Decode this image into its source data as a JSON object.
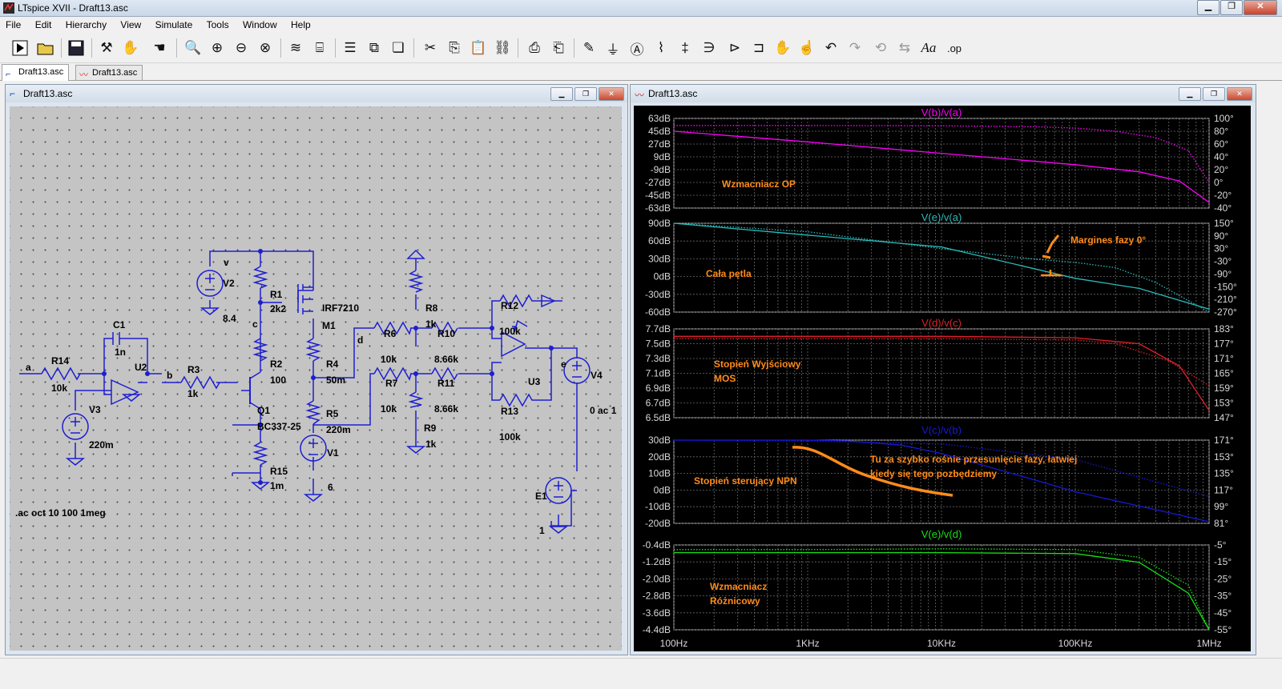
{
  "app": {
    "title": "LTspice XVII - Draft13.asc"
  },
  "menu": [
    "File",
    "Edit",
    "Hierarchy",
    "View",
    "Simulate",
    "Tools",
    "Window",
    "Help"
  ],
  "tabs": [
    {
      "label": "Draft13.asc"
    },
    {
      "label": "Draft13.asc"
    }
  ],
  "schematic": {
    "title": "Draft13.asc",
    "directive": ".ac oct 10 100 1meg",
    "labels": {
      "a": "a",
      "b": "b",
      "c": "c",
      "d": "d",
      "e": "e",
      "v": "v",
      "R14": "R14",
      "R14v": "10k",
      "C1": "C1",
      "C1v": "1n",
      "U2": "U2",
      "R3": "R3",
      "R3v": "1k",
      "V3": "V3",
      "V3v": "220m",
      "V2": "V2",
      "V2v": "8.4",
      "R1": "R1",
      "R1v": "2k2",
      "R2": "R2",
      "R2v": "100",
      "Q1": "Q1",
      "Q1v": "BC337-25",
      "R15": "R15",
      "R15v": "1m",
      "M1name": "IRF7210",
      "M1": "M1",
      "R4": "R4",
      "R4v": "50m",
      "R5": "R5",
      "R5v": "220m",
      "V1": "V1",
      "V1v": "6",
      "R6": "R6",
      "R6v": "10k",
      "R8": "R8",
      "R8v": "1k",
      "R10": "R10",
      "R10v": "8.66k",
      "R7": "R7",
      "R7v": "10k",
      "R9": "R9",
      "R9v": "1k",
      "R11": "R11",
      "R11v": "8.66k",
      "R12": "R12",
      "R12v": "100k",
      "R13": "R13",
      "R13v": "100k",
      "U3": "U3",
      "V4": "V4",
      "V4v": "0 ac 1",
      "E1": "E1",
      "E1v": "1"
    }
  },
  "waveform": {
    "title": "Draft13.asc"
  },
  "chart_data": [
    {
      "type": "line",
      "title": "V(b)/v(a)",
      "xscale": "log",
      "xlim": [
        100,
        1000000
      ],
      "left_ticks": [
        "63dB",
        "45dB",
        "27dB",
        "9dB",
        "-9dB",
        "-27dB",
        "-45dB",
        "-63dB"
      ],
      "right_ticks": [
        "100°",
        "80°",
        "60°",
        "40°",
        "20°",
        "0°",
        "-20°",
        "-40°"
      ],
      "ylim_left": [
        -63,
        63
      ],
      "ylim_right": [
        -40,
        100
      ],
      "annotation": "Wzmacniacz OP",
      "color": "#ff00ff",
      "series": [
        {
          "axis": "left",
          "style": "solid",
          "x": [
            100,
            1000,
            10000,
            100000,
            300000,
            600000,
            1000000
          ],
          "y": [
            45,
            30,
            14,
            -2,
            -12,
            -25,
            -55
          ]
        },
        {
          "axis": "right",
          "style": "dotted",
          "x": [
            100,
            1000,
            10000,
            50000,
            100000,
            200000,
            400000,
            700000,
            1000000
          ],
          "y": [
            89,
            89,
            88.5,
            87,
            85,
            80,
            70,
            50,
            0
          ]
        }
      ]
    },
    {
      "type": "line",
      "title": "V(e)/v(a)",
      "xscale": "log",
      "xlim": [
        100,
        1000000
      ],
      "left_ticks": [
        "90dB",
        "60dB",
        "30dB",
        "0dB",
        "-30dB",
        "-60dB"
      ],
      "right_ticks": [
        "150°",
        "90°",
        "30°",
        "-30°",
        "-90°",
        "-150°",
        "-210°",
        "-270°"
      ],
      "ylim_left": [
        -60,
        90
      ],
      "ylim_right": [
        -270,
        150
      ],
      "annotations": [
        "Cała pętla",
        "Margines fazy 0°"
      ],
      "color": "#2bbcbc",
      "series": [
        {
          "axis": "left",
          "style": "solid",
          "x": [
            100,
            1000,
            10000,
            100000,
            300000,
            1000000
          ],
          "y": [
            90,
            70,
            50,
            -3,
            -20,
            -55
          ]
        },
        {
          "axis": "right",
          "style": "dotted",
          "x": [
            100,
            1000,
            10000,
            50000,
            100000,
            200000,
            400000,
            1000000
          ],
          "y": [
            150,
            110,
            30,
            -20,
            -35,
            -60,
            -130,
            -270
          ]
        }
      ]
    },
    {
      "type": "line",
      "title": "V(d)/v(c)",
      "xscale": "log",
      "xlim": [
        100,
        1000000
      ],
      "left_ticks": [
        "7.7dB",
        "7.5dB",
        "7.3dB",
        "7.1dB",
        "6.9dB",
        "6.7dB",
        "6.5dB"
      ],
      "right_ticks": [
        "183°",
        "177°",
        "171°",
        "165°",
        "159°",
        "153°",
        "147°"
      ],
      "ylim_left": [
        6.5,
        7.7
      ],
      "ylim_right": [
        147,
        183
      ],
      "annotation": "Stopień Wyjściowy MOS",
      "color": "#e0202a",
      "series": [
        {
          "axis": "left",
          "style": "solid",
          "x": [
            100,
            10000,
            100000,
            300000,
            600000,
            1000000
          ],
          "y": [
            7.6,
            7.6,
            7.58,
            7.5,
            7.2,
            6.6
          ]
        },
        {
          "axis": "right",
          "style": "dotted",
          "x": [
            100,
            10000,
            100000,
            200000,
            500000,
            1000000
          ],
          "y": [
            179,
            179,
            178.5,
            177,
            170,
            160
          ]
        }
      ]
    },
    {
      "type": "line",
      "title": "V(c)/v(b)",
      "xscale": "log",
      "xlim": [
        100,
        1000000
      ],
      "left_ticks": [
        "30dB",
        "20dB",
        "10dB",
        "0dB",
        "-10dB",
        "-20dB"
      ],
      "right_ticks": [
        "171°",
        "153°",
        "135°",
        "117°",
        "99°",
        "81°"
      ],
      "ylim_left": [
        -20,
        30
      ],
      "ylim_right": [
        81,
        171
      ],
      "annotations": [
        "Stopień sterujący NPN",
        "Tu za szybko rośnie przesunięcie fazy, łatwiej kiedy się tego pozbędziemy"
      ],
      "color": "#1818d8",
      "series": [
        {
          "axis": "left",
          "style": "solid",
          "x": [
            100,
            1000,
            2000,
            5000,
            10000,
            50000,
            100000,
            1000000
          ],
          "y": [
            30,
            30,
            29.5,
            27,
            22,
            6,
            -1,
            -19
          ]
        },
        {
          "axis": "right",
          "style": "dotted",
          "x": [
            100,
            1000,
            10000,
            100000,
            1000000
          ],
          "y": [
            171,
            170,
            167,
            150,
            110
          ]
        }
      ]
    },
    {
      "type": "line",
      "title": "V(e)/v(d)",
      "xscale": "log",
      "xlim": [
        100,
        1000000
      ],
      "left_ticks": [
        "-0.4dB",
        "-1.2dB",
        "-2.0dB",
        "-2.8dB",
        "-3.6dB",
        "-4.4dB"
      ],
      "right_ticks": [
        "-5°",
        "-15°",
        "-25°",
        "-35°",
        "-45°",
        "-55°"
      ],
      "ylim_left": [
        -4.4,
        0
      ],
      "ylim_right": [
        -57,
        -2
      ],
      "annotation": "Wzmacniacz Różnicowy",
      "color": "#18e018",
      "series": [
        {
          "axis": "left",
          "style": "solid",
          "x": [
            100,
            10000,
            100000,
            300000,
            700000,
            1000000
          ],
          "y": [
            -0.4,
            -0.4,
            -0.45,
            -0.9,
            -2.5,
            -4.4
          ]
        },
        {
          "axis": "right",
          "style": "dotted",
          "x": [
            100,
            1000,
            10000,
            100000,
            300000,
            700000,
            1000000
          ],
          "y": [
            -5,
            -5,
            -4.5,
            -5,
            -10,
            -28,
            -57
          ]
        }
      ]
    }
  ],
  "x_ticks": [
    "100Hz",
    "1KHz",
    "10KHz",
    "100KHz",
    "1MHz"
  ]
}
